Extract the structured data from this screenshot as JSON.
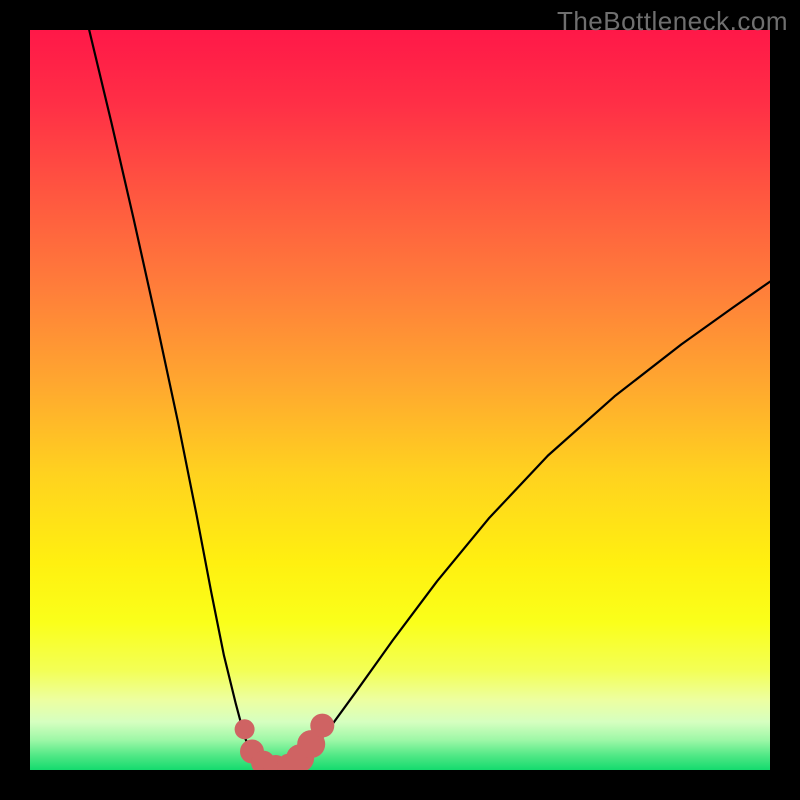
{
  "watermark": "TheBottleneck.com",
  "chart_data": {
    "type": "line",
    "title": "",
    "xlabel": "",
    "ylabel": "",
    "xlim": [
      0,
      1
    ],
    "ylim": [
      0,
      1
    ],
    "description": "Bottleneck V-curve: two branches descending to a flat minimum near x≈0.30–0.37; left branch is steep, right branch shallower. Background is a vertical red→yellow→green gradient.",
    "series": [
      {
        "name": "left-branch",
        "x": [
          0.08,
          0.11,
          0.14,
          0.17,
          0.2,
          0.225,
          0.245,
          0.262,
          0.278,
          0.29,
          0.3
        ],
        "y": [
          1.0,
          0.875,
          0.745,
          0.61,
          0.47,
          0.345,
          0.24,
          0.155,
          0.09,
          0.045,
          0.02
        ]
      },
      {
        "name": "trough",
        "x": [
          0.3,
          0.32,
          0.34,
          0.36,
          0.375
        ],
        "y": [
          0.02,
          0.006,
          0.002,
          0.006,
          0.02
        ]
      },
      {
        "name": "right-branch",
        "x": [
          0.375,
          0.4,
          0.44,
          0.49,
          0.55,
          0.62,
          0.7,
          0.79,
          0.88,
          0.95,
          1.0
        ],
        "y": [
          0.02,
          0.05,
          0.105,
          0.175,
          0.255,
          0.34,
          0.425,
          0.505,
          0.575,
          0.625,
          0.66
        ]
      }
    ],
    "highlight": {
      "name": "trough-marker",
      "color": "#cf6363",
      "points": [
        {
          "x": 0.29,
          "y": 0.055,
          "r": 10
        },
        {
          "x": 0.3,
          "y": 0.025,
          "r": 12
        },
        {
          "x": 0.315,
          "y": 0.01,
          "r": 12
        },
        {
          "x": 0.332,
          "y": 0.004,
          "r": 12
        },
        {
          "x": 0.35,
          "y": 0.006,
          "r": 12
        },
        {
          "x": 0.365,
          "y": 0.016,
          "r": 14
        },
        {
          "x": 0.38,
          "y": 0.035,
          "r": 14
        },
        {
          "x": 0.395,
          "y": 0.06,
          "r": 12
        }
      ]
    },
    "gradient_stops": [
      {
        "offset": 0.0,
        "color": "#ff1848"
      },
      {
        "offset": 0.1,
        "color": "#ff2f46"
      },
      {
        "offset": 0.22,
        "color": "#ff5640"
      },
      {
        "offset": 0.35,
        "color": "#ff7e3a"
      },
      {
        "offset": 0.48,
        "color": "#ffa82f"
      },
      {
        "offset": 0.6,
        "color": "#ffd21f"
      },
      {
        "offset": 0.72,
        "color": "#fff010"
      },
      {
        "offset": 0.8,
        "color": "#faff1a"
      },
      {
        "offset": 0.865,
        "color": "#f3ff55"
      },
      {
        "offset": 0.905,
        "color": "#edffa0"
      },
      {
        "offset": 0.935,
        "color": "#d6ffc0"
      },
      {
        "offset": 0.96,
        "color": "#9cf7a6"
      },
      {
        "offset": 0.98,
        "color": "#52e886"
      },
      {
        "offset": 1.0,
        "color": "#14db6e"
      }
    ]
  }
}
